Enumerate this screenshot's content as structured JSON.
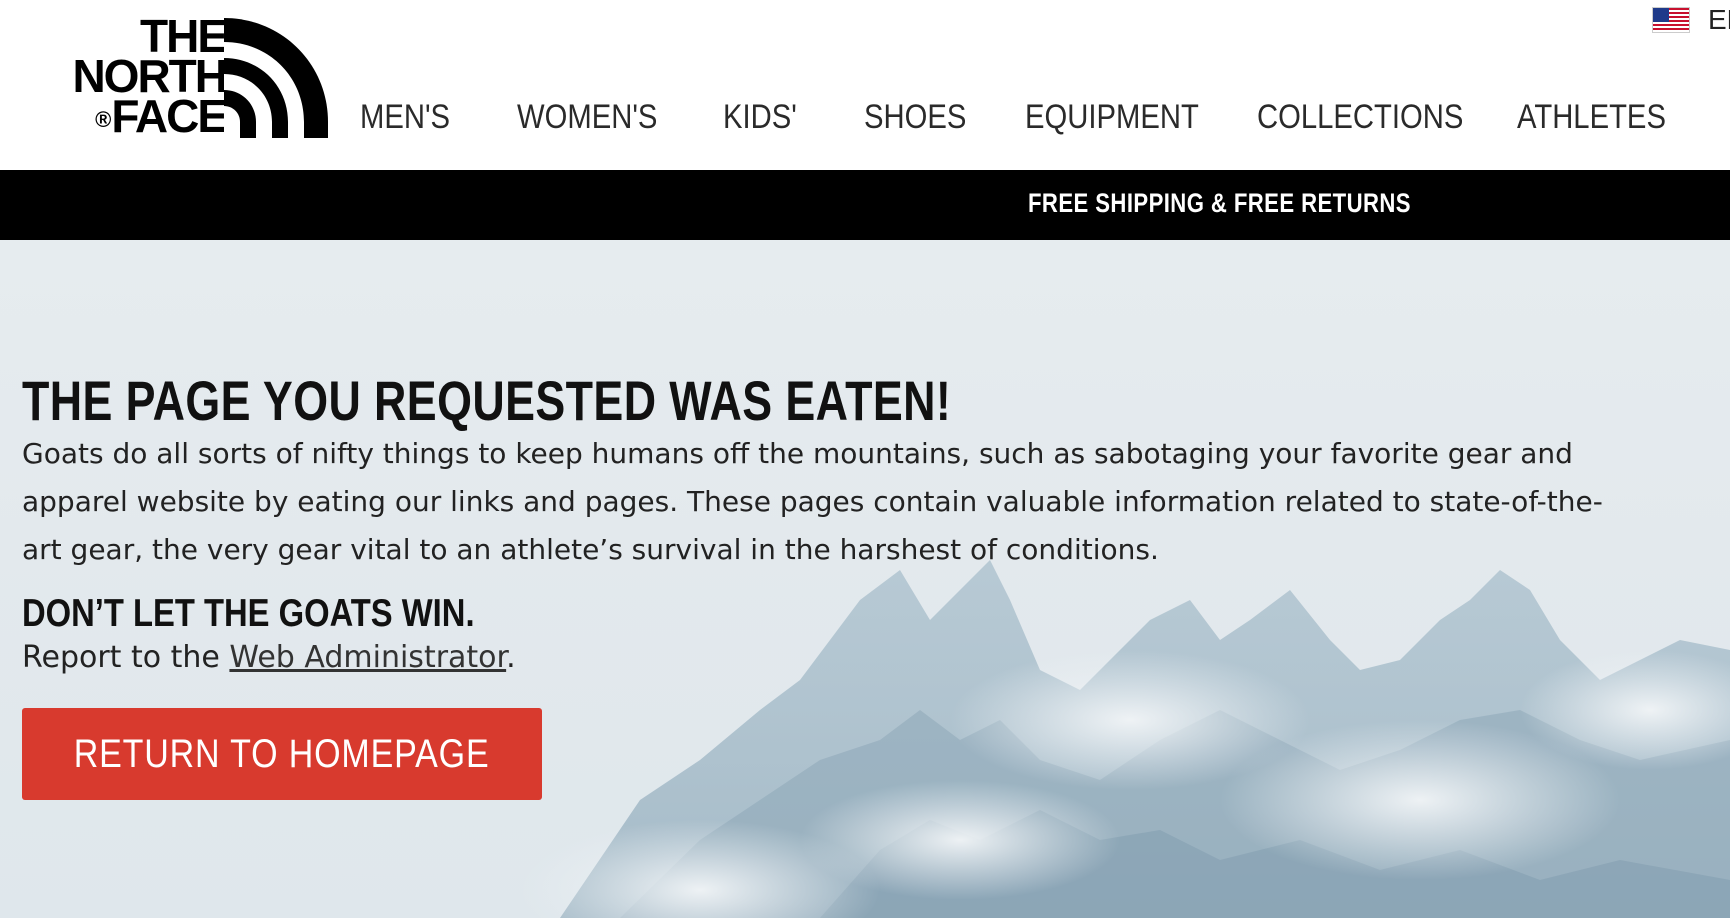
{
  "brand": {
    "logo_line1": "THE",
    "logo_line2": "NORTH",
    "logo_line3": "FACE",
    "logo_reg": "®"
  },
  "nav": {
    "items": [
      "MEN'S",
      "WOMEN'S",
      "KIDS'",
      "SHOES",
      "EQUIPMENT",
      "COLLECTIONS",
      "ATHLETES"
    ]
  },
  "language": {
    "label": "EN",
    "flag_icon": "us-flag-icon"
  },
  "promo": {
    "text": "FREE SHIPPING & FREE RETURNS"
  },
  "error_page": {
    "headline": "THE PAGE YOU REQUESTED WAS EATEN!",
    "body": "Goats do all sorts of nifty things to keep humans off the mountains, such as sabotaging your favorite gear and apparel website by eating our links and pages. These pages contain valuable information related to state-of-the-art gear, the very gear vital to an athlete’s survival in the harshest of conditions.",
    "subhead": "DON’T LET THE GOATS WIN.",
    "report_prefix": "Report to the ",
    "report_link": "Web Administrator",
    "report_suffix": ".",
    "button_label": "RETURN TO HOMEPAGE"
  },
  "colors": {
    "button_bg": "#d83a2e",
    "promo_bg": "#000000",
    "hero_bg": "#e4eaee"
  }
}
